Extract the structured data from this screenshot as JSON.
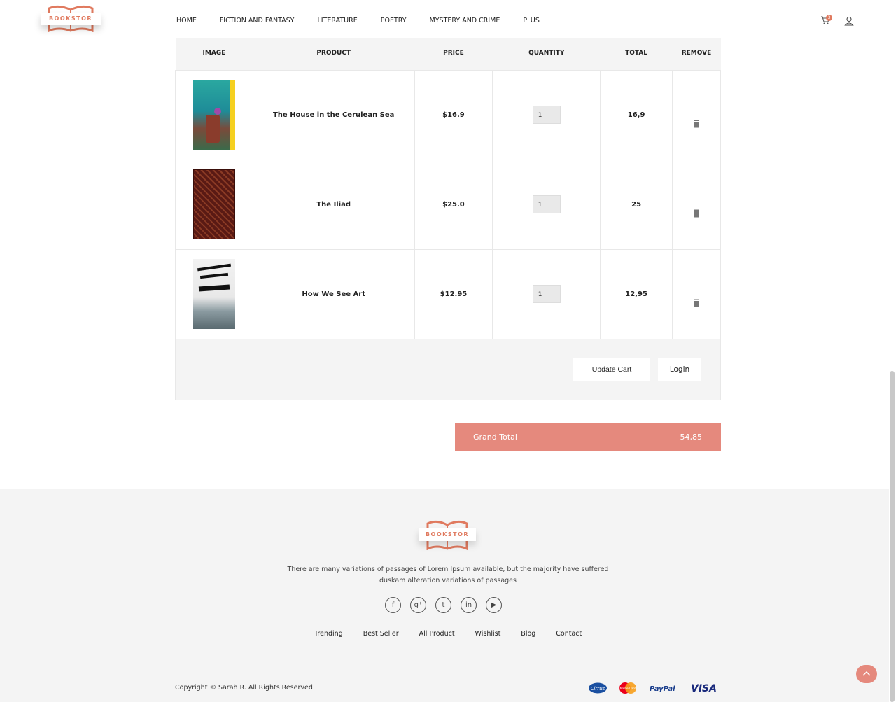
{
  "brand": {
    "name": "BOOKSTOR",
    "accent": "#e07a5f"
  },
  "nav": {
    "items": [
      "HOME",
      "FICTION AND FANTASY",
      "LITERATURE",
      "POETRY",
      "MYSTERY AND CRIME",
      "PLUS"
    ],
    "cart_count": "3"
  },
  "cart": {
    "headers": {
      "image": "IMAGE",
      "product": "PRODUCT",
      "price": "PRICE",
      "quantity": "QUANTITY",
      "total": "TOTAL",
      "remove": "REMOVE"
    },
    "rows": [
      {
        "product": "The House in the Cerulean Sea",
        "price": "$16.9",
        "quantity": "1",
        "total": "16,9"
      },
      {
        "product": "The Iliad",
        "price": "$25.0",
        "quantity": "1",
        "total": "25"
      },
      {
        "product": "How We See Art",
        "price": "$12.95",
        "quantity": "1",
        "total": "12,95"
      }
    ],
    "update_label": "Update Cart",
    "login_label": "Login"
  },
  "grand_total": {
    "label": "Grand Total",
    "value": "54,85",
    "color": "#e5897d"
  },
  "footer": {
    "description": "There are many variations of passages of Lorem Ipsum available, but the majority have suffered duskam alteration variations of passages",
    "socials": [
      "facebook-icon",
      "google-plus-icon",
      "tumblr-icon",
      "linkedin-icon",
      "youtube-icon"
    ],
    "links": [
      "Trending",
      "Best Seller",
      "All Product",
      "Wishlist",
      "Blog",
      "Contact"
    ],
    "copyright": "Copyright © Sarah R. All Rights Reserved",
    "payments": {
      "cirrus": "Cirrus",
      "mastercard": "MasterCard",
      "paypal": "PayPal",
      "visa": "VISA"
    }
  }
}
